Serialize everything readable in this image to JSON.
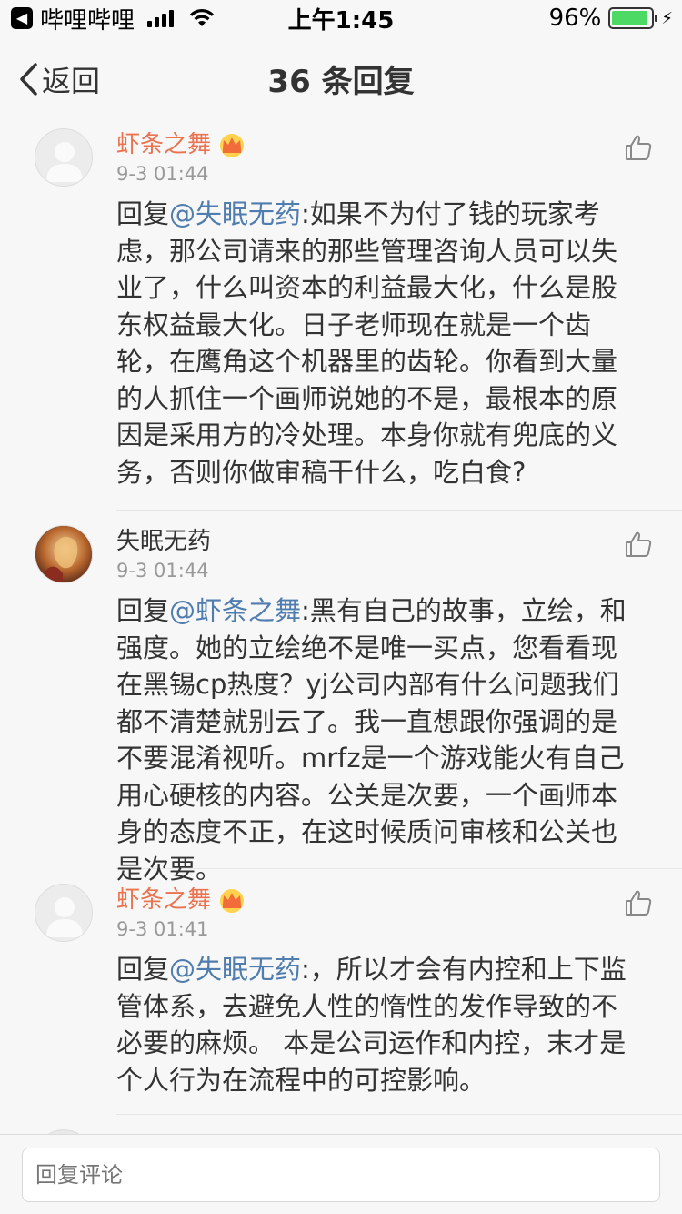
{
  "status_bar": {
    "back_app": "哔哩哔哩",
    "time": "上午1:45",
    "battery": "96%"
  },
  "nav": {
    "back_label": "返回",
    "title": "36 条回复"
  },
  "comments": [
    {
      "username": "虾条之舞",
      "vip": true,
      "timestamp": "9-3 01:44",
      "prefix": "回复",
      "mention": "@失眠无药",
      "text": ":如果不为付了钱的玩家考虑，那公司请来的那些管理咨询人员可以失业了，什么叫资本的利益最大化，什么是股东权益最大化。日子老师现在就是一个齿轮，在鹰角这个机器里的齿轮。你看到大量的人抓住一个画师说她的不是，最根本的原因是采用方的冷处理。本身你就有兜底的义务，否则你做审稿干什么，吃白食?"
    },
    {
      "username": "失眠无药",
      "vip": false,
      "timestamp": "9-3 01:44",
      "prefix": "回复",
      "mention": "@虾条之舞",
      "text": ":黑有自己的故事，立绘，和强度。她的立绘绝不是唯一买点，您看看现在黑锡cp热度？yj公司内部有什么问题我们都不清楚就别云了。我一直想跟你强调的是不要混淆视听。mrfz是一个游戏能火有自己用心硬核的内容。公关是次要，一个画师本身的态度不正，在这时候质问审核和公关也是次要。"
    },
    {
      "username": "虾条之舞",
      "vip": true,
      "timestamp": "9-3 01:41",
      "prefix": "回复",
      "mention": "@失眠无药",
      "text": ":，所以才会有内控和上下监管体系，去避免人性的惰性的发作导致的不必要的麻烦。 本是公司运作和内控，末才是个人行为在流程中的可控影响。"
    }
  ],
  "reply_bar": {
    "placeholder": "回复评论"
  },
  "colors": {
    "vip_name": "#eb7350",
    "mention": "#507daf",
    "battery": "#4cd964"
  }
}
